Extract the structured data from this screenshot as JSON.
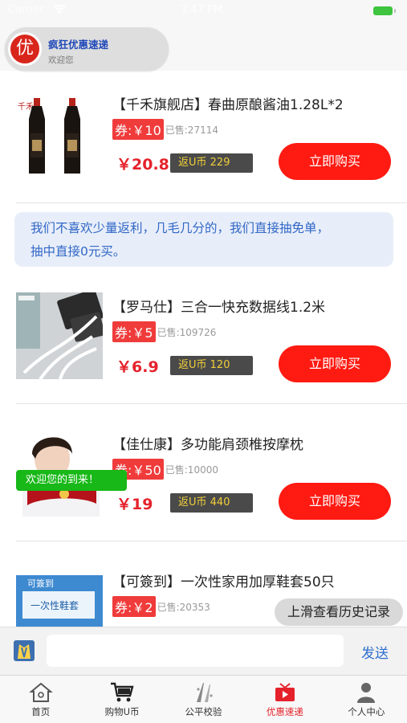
{
  "statusbar": {
    "carrier": "Carrier",
    "time": "3:47 PM"
  },
  "header": {
    "logo_char": "优",
    "title": "疯狂优惠速递",
    "subtitle": "欢迎您"
  },
  "products": [
    {
      "title": "【千禾旗舰店】春曲原酿酱油1.28L*2",
      "coupon": "券:￥10",
      "sold": "已售:27114",
      "price": "￥20.8",
      "ucoin": "返U币  229",
      "buy_label": "立即购买",
      "image": "soy-sauce-bottles"
    },
    {
      "title": "【罗马仕】三合一快充数据线1.2米",
      "coupon": "券:￥5",
      "sold": "已售:109726",
      "price": "￥6.9",
      "ucoin": "返U币  120",
      "buy_label": "立即购买",
      "image": "charging-cable"
    },
    {
      "title": "【佳仕康】多功能肩颈椎按摩枕",
      "coupon": "券:￥50",
      "sold": "已售:10000",
      "price": "￥19",
      "ucoin": "返U币  440",
      "buy_label": "立即购买",
      "image": "massage-pillow"
    },
    {
      "title": "【可簽到】一次性家用加厚鞋套50只",
      "coupon": "券:￥2",
      "sold": "已售:20353",
      "image": "shoe-covers"
    }
  ],
  "notice": {
    "line1": "我们不喜欢少量返利，几毛几分的，我们直接抽免单，",
    "line2": "抽中直接0元买。"
  },
  "toast": "欢迎您的到来！",
  "history_button": "上滑查看历史记录",
  "chat": {
    "placeholder": "",
    "send_label": "发送"
  },
  "tabs": [
    {
      "label": "首页",
      "icon": "home-icon",
      "active": false
    },
    {
      "label": "购物U币",
      "icon": "cart-icon",
      "active": false
    },
    {
      "label": "公平校验",
      "icon": "verify-icon",
      "active": false
    },
    {
      "label": "优惠速递",
      "icon": "video-icon",
      "active": true
    },
    {
      "label": "个人中心",
      "icon": "person-icon",
      "active": false
    }
  ],
  "colors": {
    "accent_red": "#ff1a12",
    "price_red": "#e5222b",
    "link_blue": "#3167c7",
    "toast_green": "#18b818"
  }
}
